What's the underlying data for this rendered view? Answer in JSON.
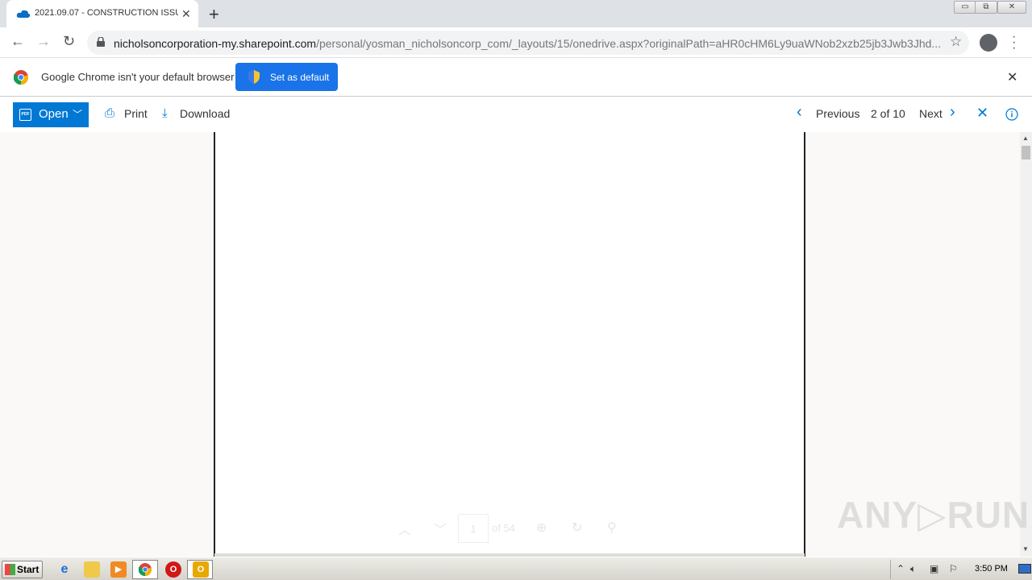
{
  "browser": {
    "tab_title": "2021.09.07 - CONSTRUCTION ISSUI",
    "tab_close": "✕",
    "new_tab": "+",
    "url_host": "nicholsoncorporation-my.sharepoint.com",
    "url_rest": "/personal/yosman_nicholsoncorp_com/_layouts/15/onedrive.aspx?originalPath=aHR0cHM6Ly9uaWNob2xzb25jb3Jwb3Jhd...",
    "window_buttons": [
      "▭",
      "⧉",
      "✕"
    ]
  },
  "infobar": {
    "message": "Google Chrome isn't your default browser",
    "button": "Set as default",
    "close": "✕"
  },
  "viewer": {
    "open_label": "Open",
    "pdf_icon_text": "PDF",
    "print_label": "Print",
    "download_label": "Download",
    "previous_label": "Previous",
    "position": "2 of 10",
    "next_label": "Next"
  },
  "pdf_controls": {
    "page_number": "1",
    "page_total": "of 54"
  },
  "watermark": "ANY▷RUN",
  "taskbar": {
    "start_label": "Start",
    "clock": "3:50 PM"
  }
}
